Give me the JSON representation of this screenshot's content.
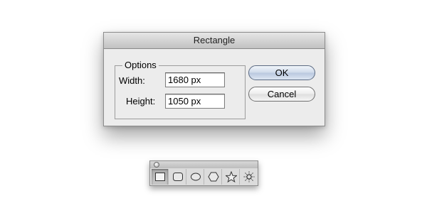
{
  "dialog": {
    "title": "Rectangle",
    "options_label": "Options",
    "width_label": "Width:",
    "width_value": "1680 px",
    "height_label": "Height:",
    "height_value": "1050 px",
    "ok_label": "OK",
    "cancel_label": "Cancel"
  },
  "palette": {
    "tools": [
      {
        "name": "rectangle-tool",
        "icon": "rectangle-icon",
        "active": true
      },
      {
        "name": "rounded-rectangle-tool",
        "icon": "rounded-rectangle-icon",
        "active": false
      },
      {
        "name": "ellipse-tool",
        "icon": "ellipse-icon",
        "active": false
      },
      {
        "name": "polygon-tool",
        "icon": "hexagon-icon",
        "active": false
      },
      {
        "name": "star-tool",
        "icon": "star-icon",
        "active": false
      },
      {
        "name": "flare-tool",
        "icon": "flare-icon",
        "active": false
      }
    ]
  }
}
